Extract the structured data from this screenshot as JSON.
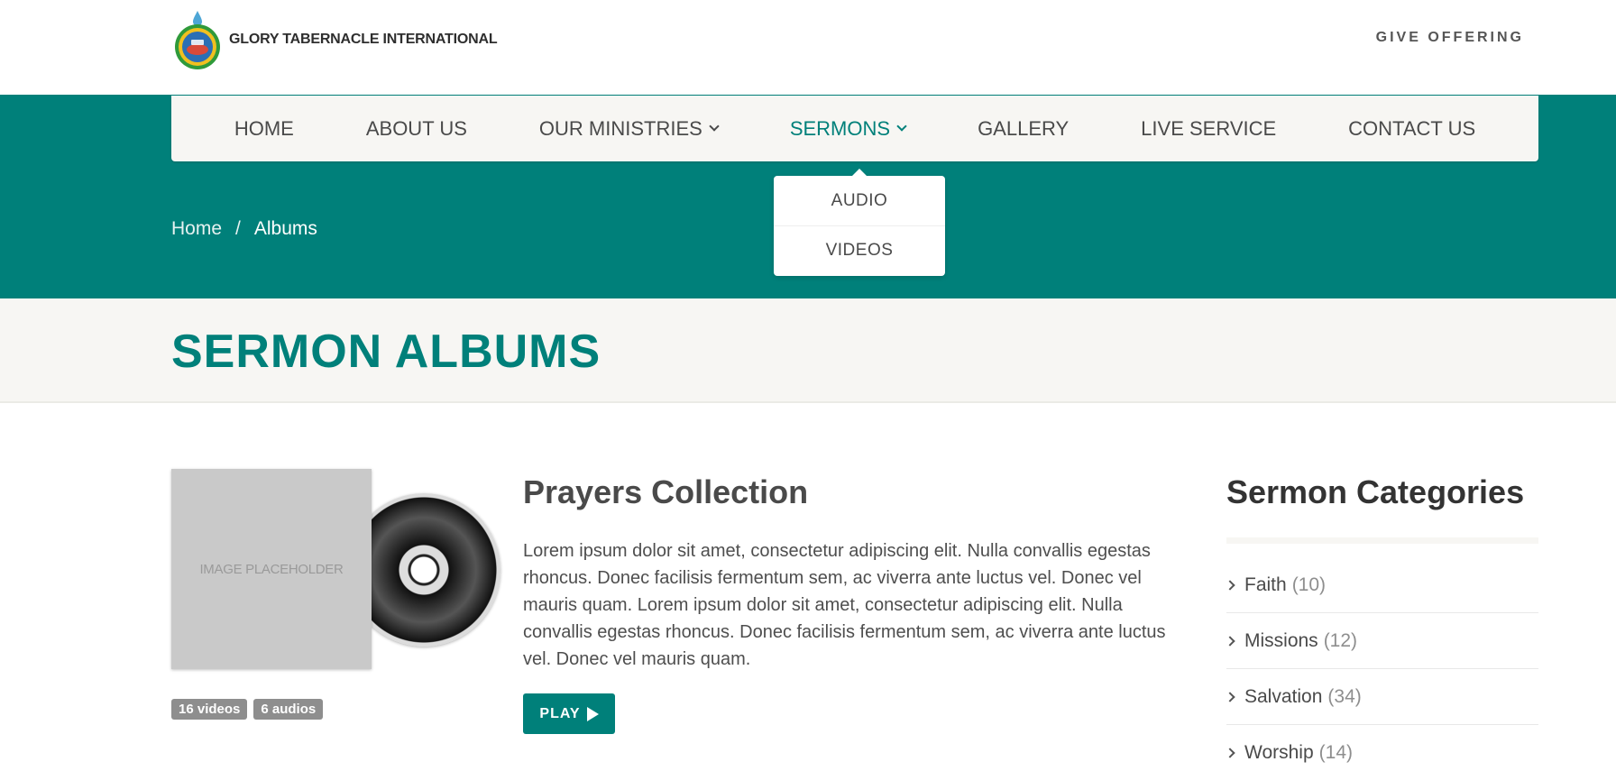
{
  "header": {
    "logo_text": "GLORY TABERNACLE INTERNATIONAL",
    "give_offering": "GIVE OFFERING"
  },
  "nav": {
    "items": [
      {
        "label": "HOME",
        "dropdown": false,
        "active": false
      },
      {
        "label": "ABOUT US",
        "dropdown": false,
        "active": false
      },
      {
        "label": "OUR MINISTRIES",
        "dropdown": true,
        "active": false
      },
      {
        "label": "SERMONS",
        "dropdown": true,
        "active": true
      },
      {
        "label": "GALLERY",
        "dropdown": false,
        "active": false
      },
      {
        "label": "LIVE SERVICE",
        "dropdown": false,
        "active": false
      },
      {
        "label": "CONTACT US",
        "dropdown": false,
        "active": false
      }
    ],
    "sermons_dropdown": [
      "AUDIO",
      "VIDEOS"
    ]
  },
  "breadcrumb": {
    "home": "Home",
    "separator": "/",
    "current": "Albums"
  },
  "page": {
    "title": "SERMON ALBUMS"
  },
  "album": {
    "placeholder_text": "IMAGE PLACEHOLDER",
    "videos_badge": "16 videos",
    "audios_badge": "6 audios",
    "title": "Prayers Collection",
    "description": "Lorem ipsum dolor sit amet, consectetur adipiscing elit. Nulla convallis egestas rhoncus. Donec facilisis fermentum sem, ac viverra ante luctus vel. Donec vel mauris quam. Lorem ipsum dolor sit amet, consectetur adipiscing elit. Nulla convallis egestas rhoncus. Donec facilisis fermentum sem, ac viverra ante luctus vel. Donec vel mauris quam.",
    "play_label": "PLAY"
  },
  "sidebar": {
    "title": "Sermon Categories",
    "categories": [
      {
        "name": "Faith",
        "count": "(10)"
      },
      {
        "name": "Missions",
        "count": "(12)"
      },
      {
        "name": "Salvation",
        "count": "(34)"
      },
      {
        "name": "Worship",
        "count": "(14)"
      }
    ]
  },
  "colors": {
    "brand_teal": "#00807a",
    "strip_bg": "#f7f6f3",
    "badge_grey": "#8e8e8e"
  }
}
